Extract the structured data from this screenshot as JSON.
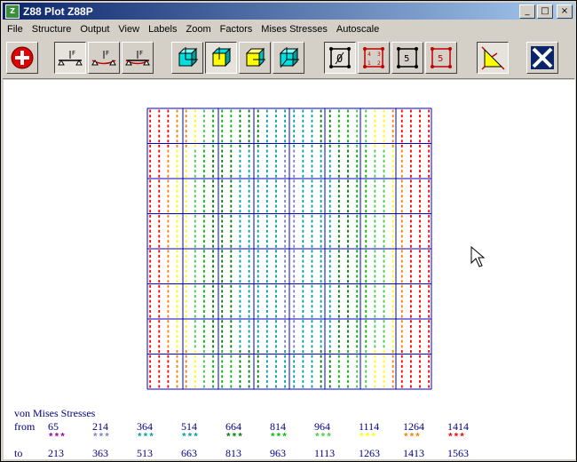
{
  "window": {
    "title": "Z88 Plot Z88P",
    "app_icon_text": "Z"
  },
  "title_buttons": {
    "minimize": "_",
    "maximize": "□",
    "close": "×"
  },
  "menu": [
    "File",
    "Structure",
    "Output",
    "View",
    "Labels",
    "Zoom",
    "Factors",
    "Mises Stresses",
    "Autoscale"
  ],
  "toolbar": {
    "buttons": [
      {
        "name": "add-button-icon",
        "pressed": false
      },
      {
        "name": "structure-undeformed-icon",
        "pressed": true
      },
      {
        "name": "structure-deformed-icon",
        "pressed": false
      },
      {
        "name": "structure-both-icon",
        "pressed": false
      },
      {
        "name": "view-cube-1-icon",
        "pressed": false
      },
      {
        "name": "view-cube-2-icon",
        "pressed": true
      },
      {
        "name": "view-cube-3-icon",
        "pressed": false
      },
      {
        "name": "view-cube-4-icon",
        "pressed": false
      },
      {
        "name": "label-none-icon",
        "pressed": true
      },
      {
        "name": "label-nodes-icon",
        "pressed": false
      },
      {
        "name": "label-elements-icon",
        "pressed": false
      },
      {
        "name": "label-all-icon",
        "pressed": false
      },
      {
        "name": "mises-stress-icon",
        "pressed": true
      },
      {
        "name": "exit-icon",
        "pressed": false
      }
    ],
    "label_glyphs": {
      "none": "0",
      "nodes_tl": "4",
      "nodes_tr": "3",
      "nodes_bl": "1",
      "nodes_br": "2",
      "element": "5"
    }
  },
  "legend": {
    "title": "von Mises Stresses",
    "from_label": "from",
    "to_label": "to",
    "star": "***",
    "from": [
      "65",
      "214",
      "364",
      "514",
      "664",
      "814",
      "964",
      "1114",
      "1264",
      "1414"
    ],
    "to": [
      "213",
      "363",
      "513",
      "663",
      "813",
      "963",
      "1113",
      "1263",
      "1413",
      "1563"
    ],
    "colors": [
      "#a000a0",
      "#8080c0",
      "#00a0a0",
      "#00a0a0",
      "#008000",
      "#00c000",
      "#40d040",
      "#ffff00",
      "#ff8000",
      "#ff0000"
    ]
  },
  "plot": {
    "grid_color": "#0000c0",
    "column_colors": [
      "#ff0000",
      "#ff8000",
      "#00a000",
      "#00a0a0",
      "#0040ff",
      "#ffff00",
      "#00c000",
      "#a000a0"
    ]
  }
}
